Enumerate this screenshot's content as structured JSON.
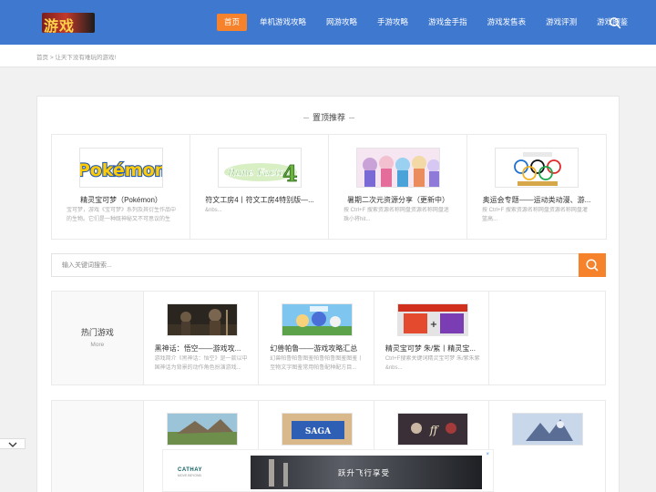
{
  "header": {
    "nav": [
      {
        "label": "首页",
        "active": true
      },
      {
        "label": "单机游戏攻略",
        "active": false
      },
      {
        "label": "网游攻略",
        "active": false
      },
      {
        "label": "手游攻略",
        "active": false
      },
      {
        "label": "游戏金手指",
        "active": false
      },
      {
        "label": "游戏发售表",
        "active": false
      },
      {
        "label": "游戏评测",
        "active": false
      },
      {
        "label": "游戏图鉴",
        "active": false
      }
    ]
  },
  "breadcrumb": {
    "home": "首页",
    "separator": ">",
    "current": "让天下没有难玩的游戏!"
  },
  "featured": {
    "title": "置顶推荐",
    "items": [
      {
        "title": "精灵宝可梦（Pokémon）",
        "desc": "宝可梦，游戏《宝可梦》系列及其衍生作品中的生物。它们是一种既神秘又不可思议的生",
        "thumb": "pokemon-logo"
      },
      {
        "title": "符文工房4丨符文工房4特别版—...",
        "desc": "&nbs...",
        "thumb": "rune-factory-4-logo"
      },
      {
        "title": "暑期二次元资源分享（更新中）",
        "desc": "按 Ctrl+F 搜索资源名称网盘资源名称网盘迷珠小将hit...",
        "thumb": "anime-girls-banner"
      },
      {
        "title": "奥运会专题——运动类动漫、游...",
        "desc": "按 Ctrl+F 搜索资源名称网盘资源名称网盘灌篮高...",
        "thumb": "olympic-rings-banner"
      }
    ]
  },
  "search": {
    "placeholder": "输入关键词搜索..."
  },
  "categories": [
    {
      "name": "热门游戏",
      "more": "More",
      "games": [
        {
          "title": "黑神话：悟空——游戏攻...",
          "desc": "游戏简介《黑神话：悟空》是一款以中国神话为背景的动作角色扮演游戏...",
          "thumb": "black-myth-wukong-banner"
        },
        {
          "title": "幻兽帕鲁——游戏攻略汇总",
          "desc": "幻兽帕鲁帕鲁图鉴帕鲁帕鲁图鉴图鉴丨至物文字图鉴常用帕鲁配种配方目...",
          "thumb": "palworld-banner"
        },
        {
          "title": "精灵宝可梦 朱/紫丨精灵宝...",
          "desc": "Ctrl+F搜索关键词精灵宝可梦 朱/紫朱紫 &nbs...",
          "thumb": "pokemon-sv-banner"
        },
        {
          "title": "",
          "desc": "",
          "thumb": ""
        }
      ]
    },
    {
      "name": "",
      "more": "",
      "games": [
        {
          "title": "",
          "desc": "",
          "thumb": "monster-hunter-banner"
        },
        {
          "title": "",
          "desc": "",
          "thumb": "saga-banner"
        },
        {
          "title": "",
          "desc": "",
          "thumb": "final-fantasy-banner"
        },
        {
          "title": "",
          "desc": "",
          "thumb": "dragon-banner"
        }
      ]
    }
  ],
  "ad": {
    "brand": "CATHAY",
    "brand_sub": "MOVE BEYOND",
    "slogan": "跃升飞行享受",
    "close": "×"
  },
  "colors": {
    "header": "#3f78cf",
    "accent": "#f6822c"
  }
}
